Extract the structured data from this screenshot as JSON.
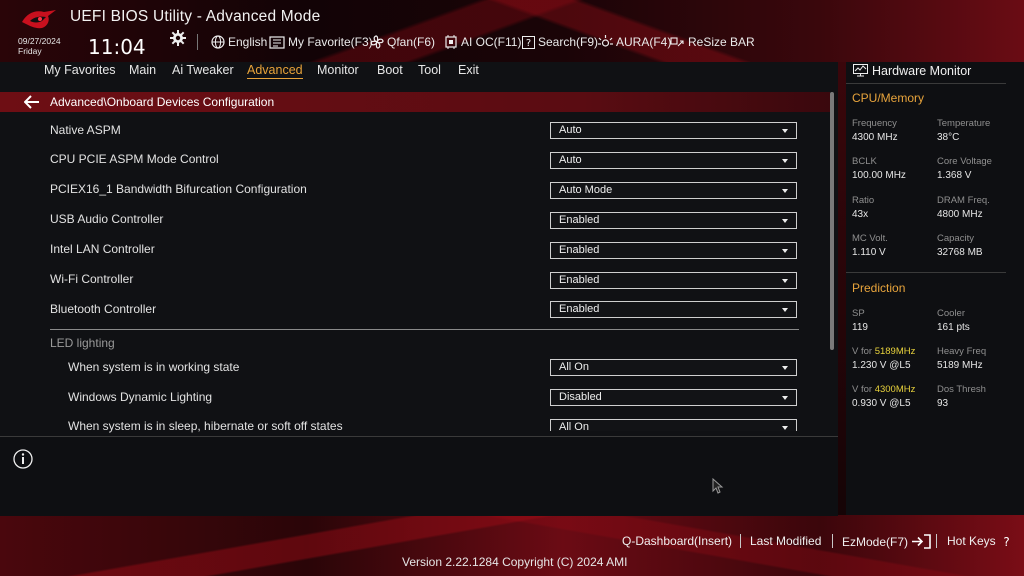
{
  "header": {
    "title": "UEFI BIOS Utility - Advanced Mode",
    "date": "09/27/2024",
    "day": "Friday",
    "time": "11:04"
  },
  "toolbar": {
    "items": [
      {
        "label": "English",
        "icon": "globe-icon"
      },
      {
        "label": "My Favorite(F3)",
        "icon": "favorite-icon"
      },
      {
        "label": "Qfan(F6)",
        "icon": "fan-icon"
      },
      {
        "label": "AI OC(F11)",
        "icon": "ai-oc-icon"
      },
      {
        "label": "Search(F9)",
        "icon": "search-help-icon"
      },
      {
        "label": "AURA(F4)",
        "icon": "aura-icon"
      },
      {
        "label": "ReSize BAR",
        "icon": "resize-bar-icon"
      }
    ]
  },
  "menu": {
    "items": [
      "My Favorites",
      "Main",
      "Ai Tweaker",
      "Advanced",
      "Monitor",
      "Boot",
      "Tool",
      "Exit"
    ],
    "active": "Advanced"
  },
  "breadcrumb": "Advanced\\Onboard Devices Configuration",
  "settings": [
    {
      "label": "Native ASPM",
      "value": "Auto"
    },
    {
      "label": "CPU PCIE ASPM Mode Control",
      "value": "Auto"
    },
    {
      "label": "PCIEX16_1 Bandwidth Bifurcation Configuration",
      "value": "Auto Mode"
    },
    {
      "label": "USB Audio Controller",
      "value": "Enabled"
    },
    {
      "label": "Intel LAN Controller",
      "value": "Enabled"
    },
    {
      "label": "Wi-Fi Controller",
      "value": "Enabled"
    },
    {
      "label": "Bluetooth Controller",
      "value": "Enabled"
    }
  ],
  "led_section": {
    "label": "LED lighting",
    "settings": [
      {
        "label": "When system is in working state",
        "value": "All On"
      },
      {
        "label": "Windows Dynamic Lighting",
        "value": "Disabled"
      },
      {
        "label": "When system is in sleep, hibernate or soft off states",
        "value": "All On"
      }
    ]
  },
  "hardware_monitor": {
    "title": "Hardware Monitor",
    "cpu_memory": {
      "heading": "CPU/Memory",
      "rows": [
        [
          {
            "k": "Frequency",
            "v": "4300 MHz"
          },
          {
            "k": "Temperature",
            "v": "38°C"
          }
        ],
        [
          {
            "k": "BCLK",
            "v": "100.00 MHz"
          },
          {
            "k": "Core Voltage",
            "v": "1.368 V"
          }
        ],
        [
          {
            "k": "Ratio",
            "v": "43x"
          },
          {
            "k": "DRAM Freq.",
            "v": "4800 MHz"
          }
        ],
        [
          {
            "k": "MC Volt.",
            "v": "1.110 V"
          },
          {
            "k": "Capacity",
            "v": "32768 MB"
          }
        ]
      ]
    },
    "prediction": {
      "heading": "Prediction",
      "rows": [
        [
          {
            "k": "SP",
            "v": "119"
          },
          {
            "k": "Cooler",
            "v": "161 pts"
          }
        ],
        [
          {
            "k_prefix": "V for ",
            "k_highlight": "5189MHz",
            "v": "1.230 V @L5"
          },
          {
            "k": "Heavy Freq",
            "v": "5189 MHz"
          }
        ],
        [
          {
            "k_prefix": "V for ",
            "k_highlight": "4300MHz",
            "v": "0.930 V @L5"
          },
          {
            "k": "Dos Thresh",
            "v": "93"
          }
        ]
      ]
    }
  },
  "footer": {
    "q_dashboard": "Q-Dashboard(Insert)",
    "last_modified": "Last Modified",
    "ezmode": "EzMode(F7)",
    "hot_keys": "Hot Keys",
    "version": "Version 2.22.1284 Copyright (C) 2024 AMI"
  },
  "colors": {
    "accent": "#e7a33a",
    "highlight": "#e8d23c",
    "brand_red": "#6e0e14"
  }
}
